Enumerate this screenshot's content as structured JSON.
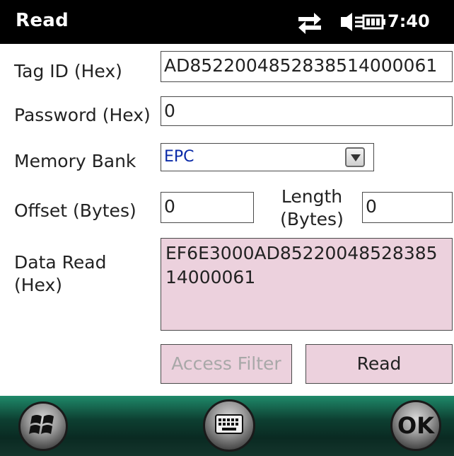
{
  "titlebar": {
    "title": "Read",
    "time": "7:40",
    "icons": [
      "connectivity-icon",
      "volume-icon",
      "battery-icon"
    ]
  },
  "form": {
    "tag_id_label": "Tag ID (Hex)",
    "tag_id_value": "AD852200485283851400006​1",
    "password_label": "Password (Hex)",
    "password_value": "0",
    "memory_bank_label": "Memory Bank",
    "memory_bank_value": "EPC",
    "offset_label": "Offset (Bytes)",
    "offset_value": "0",
    "length_label_line1": "Length",
    "length_label_line2": "(Bytes)",
    "length_value": "0",
    "data_read_label_line1": "Data Read",
    "data_read_label_line2": "(Hex)",
    "data_read_value": "EF6E3000AD852200485283851400006​1"
  },
  "buttons": {
    "access_filter": "Access Filter",
    "read": "Read"
  },
  "bottombar": {
    "ok_label": "OK",
    "icons": [
      "windows-start-icon",
      "keyboard-icon",
      "ok-icon"
    ]
  },
  "colors": {
    "titlebar_bg": "#000000",
    "pink_fill": "#ecd1dd",
    "select_text": "#0a2aa8",
    "bottombar_green": "#1f8a6a"
  }
}
